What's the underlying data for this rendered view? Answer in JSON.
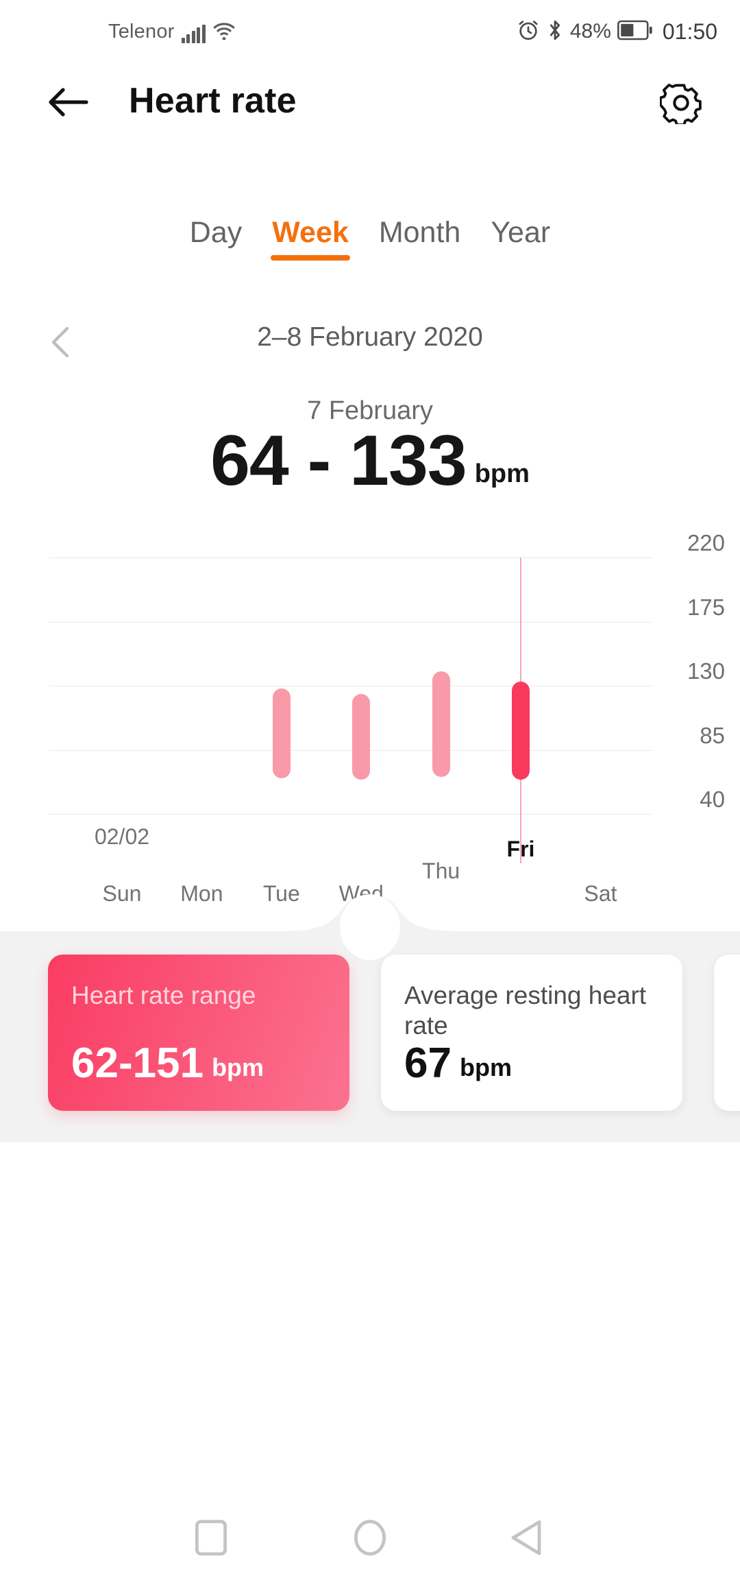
{
  "status_bar": {
    "carrier": "Telenor",
    "battery_percent": "48%",
    "time": "01:50",
    "icons": [
      "signal-bars-icon",
      "wifi-icon",
      "alarm-clock-icon",
      "bluetooth-icon",
      "battery-icon"
    ]
  },
  "app_bar": {
    "title": "Heart rate",
    "back_icon": "back-arrow-icon",
    "settings_icon": "gear-icon"
  },
  "tabs": [
    {
      "label": "Day",
      "active": false
    },
    {
      "label": "Week",
      "active": true
    },
    {
      "label": "Month",
      "active": false
    },
    {
      "label": "Year",
      "active": false
    }
  ],
  "week_nav": {
    "range": "2–8 February 2020",
    "prev_icon": "chevron-left-icon"
  },
  "headline": {
    "day": "7 February",
    "value": "64 - 133",
    "unit": "bpm"
  },
  "chart_data": {
    "type": "bar",
    "title": "Heart rate",
    "xlabel": "",
    "ylabel": "bpm",
    "ylim": [
      40,
      220
    ],
    "yticks": [
      220,
      175,
      130,
      85,
      40
    ],
    "grid": true,
    "legend": false,
    "start_date_label": "02/02",
    "categories": [
      "Sun",
      "Mon",
      "Tue",
      "Wed",
      "Thu",
      "Fri",
      "Sat"
    ],
    "selected_category": "Fri",
    "series": [
      {
        "name": "Heart rate range (min-max)",
        "low": [
          null,
          null,
          65,
          64,
          66,
          64,
          null
        ],
        "high": [
          null,
          null,
          128,
          124,
          140,
          133,
          null
        ]
      }
    ],
    "colors": {
      "bar": "#F99AA9",
      "bar_selected": "#F73A5E",
      "cursor_line": "#F8A6B3",
      "grid": "#ECEAEA"
    }
  },
  "cards": [
    {
      "title": "Heart rate range",
      "value": "62-151",
      "unit": "bpm",
      "style": "pink"
    },
    {
      "title": "Average resting heart rate",
      "value": "67",
      "unit": "bpm",
      "style": "white"
    }
  ],
  "nav_bar": {
    "recents_icon": "square-recents-icon",
    "home_icon": "circle-home-icon",
    "back_icon": "triangle-back-icon"
  }
}
